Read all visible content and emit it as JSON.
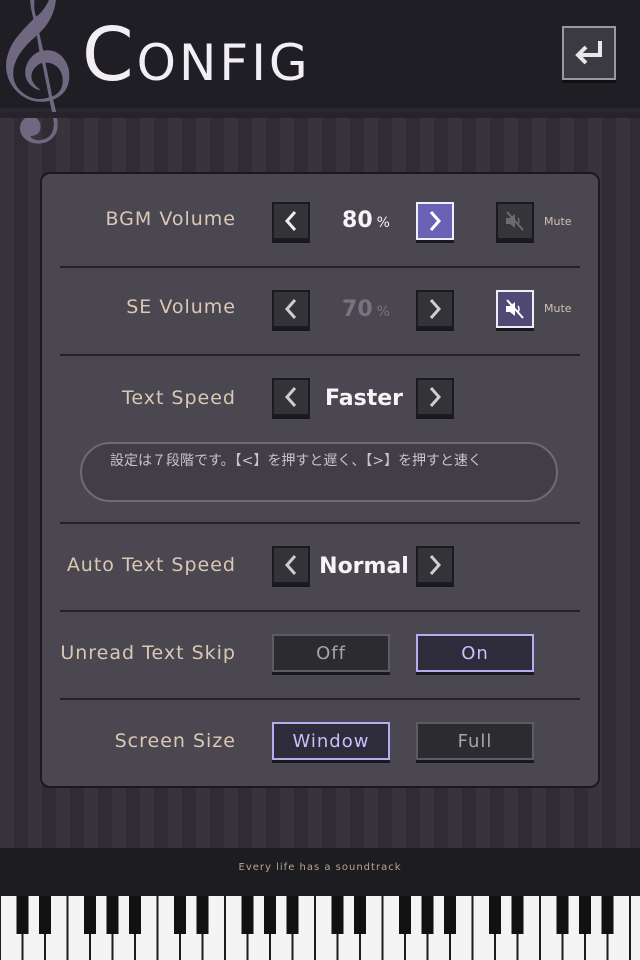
{
  "header": {
    "title_first": "C",
    "title_rest": "ONFIG",
    "clef_glyph": "𝄞",
    "back_icon": "return-arrow-icon"
  },
  "settings": {
    "bgm": {
      "label": "BGM Volume",
      "value": "80",
      "unit": "%",
      "mute_label": "Mute",
      "mute_icon": "speaker-muted-icon"
    },
    "se": {
      "label": "SE Volume",
      "value": "70",
      "unit": "%",
      "mute_label": "Mute",
      "mute_icon": "speaker-muted-icon"
    },
    "text_speed": {
      "label": "Text Speed",
      "value": "Faster",
      "hint": "設定は７段階です。【<】を押すと遅く、【>】を押すと速く"
    },
    "auto_text_speed": {
      "label": "Auto Text Speed",
      "value": "Normal"
    },
    "unread_skip": {
      "label": "Unread Text Skip",
      "off": "Off",
      "on": "On",
      "selected": "On"
    },
    "screen_size": {
      "label": "Screen Size",
      "window": "Window",
      "full": "Full",
      "selected": "Window"
    }
  },
  "footer": {
    "tagline": "Every life has a soundtrack"
  },
  "colors": {
    "accent": "#6c62b5",
    "panel": "#4a4751",
    "label": "#d9c9b3"
  }
}
